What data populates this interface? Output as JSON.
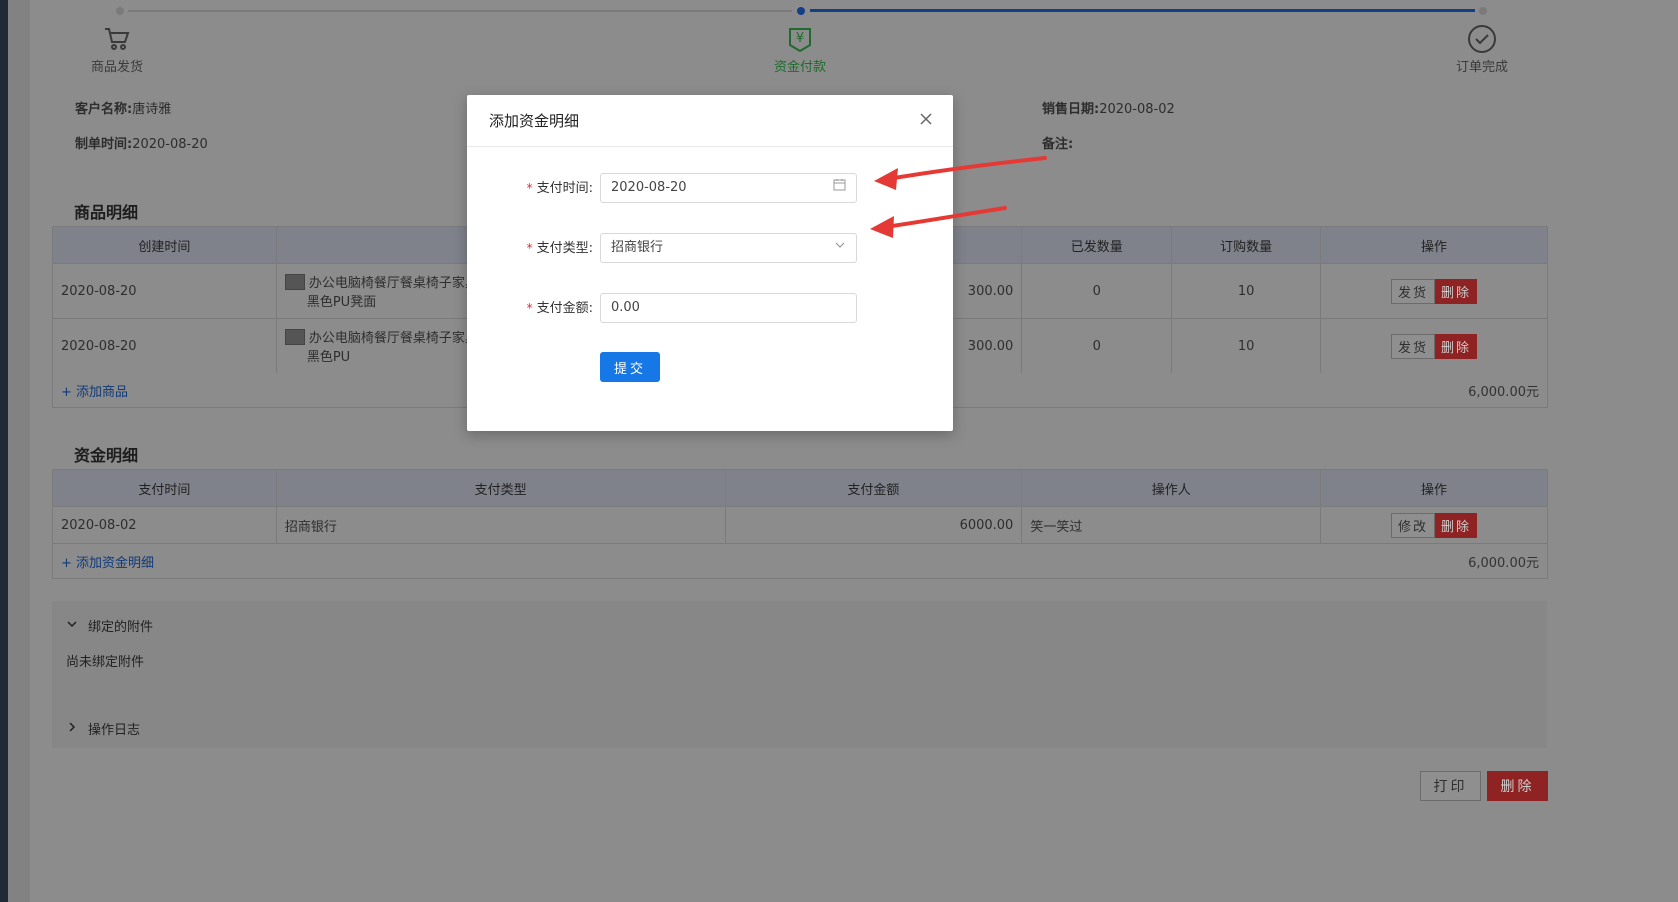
{
  "steps": [
    {
      "label": "商品发货",
      "icon": "cart-icon"
    },
    {
      "label": "资金付款",
      "icon": "yen-payment-icon"
    },
    {
      "label": "订单完成",
      "icon": "check-circle-icon"
    }
  ],
  "info": {
    "customer_label": "客户名称:",
    "customer_value": "唐诗雅",
    "created_label": "制单时间:",
    "created_value": "2020-08-20",
    "sale_date_label": "销售日期:",
    "sale_date_value": "2020-08-02",
    "note_label": "备注:",
    "note_value": ""
  },
  "goods": {
    "title": "商品明细",
    "headers": [
      "创建时间",
      "",
      "",
      "已发数量",
      "订购数量",
      "操作"
    ],
    "rows": [
      {
        "date": "2020-08-20",
        "name1": "办公电脑椅餐厅餐桌椅子家具",
        "name2": "黑色PU凳面",
        "price": "300.00",
        "sent": "0",
        "ordered": "10",
        "btn1": "发货",
        "btn2": "删除"
      },
      {
        "date": "2020-08-20",
        "name1": "办公电脑椅餐厅餐桌椅子家具",
        "name2": "黑色PU",
        "price": "300.00",
        "sent": "0",
        "ordered": "10",
        "btn1": "发货",
        "btn2": "删除"
      }
    ],
    "add_link": "+ 添加商品",
    "total": "6,000.00元"
  },
  "funds": {
    "title": "资金明细",
    "headers": [
      "支付时间",
      "支付类型",
      "支付金额",
      "操作人",
      "操作"
    ],
    "rows": [
      {
        "date": "2020-08-02",
        "type": "招商银行",
        "amount": "6000.00",
        "operator": "笑一笑过",
        "btn1": "修改",
        "btn2": "删除"
      }
    ],
    "add_link": "+ 添加资金明细",
    "total": "6,000.00元"
  },
  "attachments": {
    "title": "绑定的附件",
    "empty_text": "尚未绑定附件",
    "log_title": "操作日志"
  },
  "bottom": {
    "print": "打印",
    "delete": "删除"
  },
  "modal": {
    "title": "添加资金明细",
    "pay_time_label": "支付时间:",
    "pay_time_value": "2020-08-20",
    "pay_type_label": "支付类型:",
    "pay_type_value": "招商银行",
    "pay_amount_label": "支付金额:",
    "pay_amount_value": "0.00",
    "submit": "提交"
  },
  "colors": {
    "primary": "#1677e6",
    "danger": "#d32f2f",
    "arrow": "#e53935",
    "active_step": "#1e6b2d"
  }
}
